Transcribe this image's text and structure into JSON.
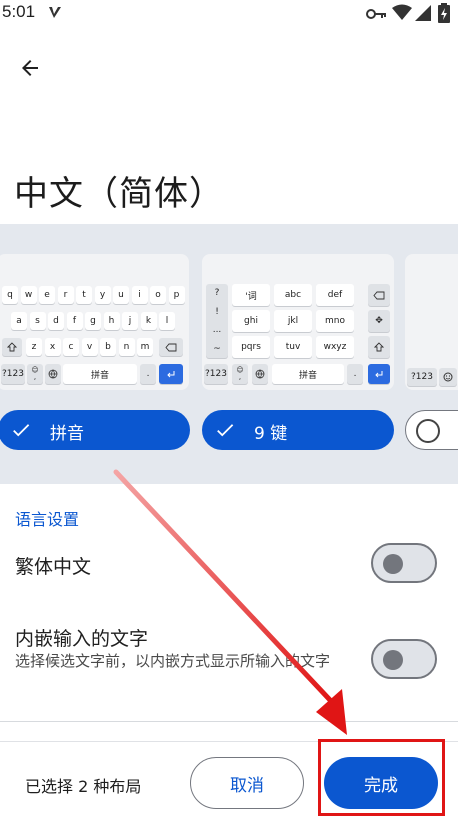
{
  "status_bar": {
    "time": "5:01",
    "icons": [
      "app-notification-icon",
      "key-icon",
      "wifi-icon",
      "signal-icon",
      "battery-charging-icon"
    ]
  },
  "header": {
    "back_icon": "arrow-back-icon",
    "title": "中文（简体）"
  },
  "keyboard_layouts": [
    {
      "label": "拼音",
      "selected": true,
      "preview": {
        "row1": [
          "q",
          "w",
          "e",
          "r",
          "t",
          "y",
          "u",
          "i",
          "o",
          "p"
        ],
        "row2": [
          "a",
          "s",
          "d",
          "f",
          "g",
          "h",
          "j",
          "k",
          "l"
        ],
        "row3": [
          "z",
          "x",
          "c",
          "v",
          "b",
          "n",
          "m"
        ],
        "space_label": "拼音",
        "symbols_key": "?123"
      }
    },
    {
      "label": "9 键",
      "selected": true,
      "preview": {
        "side_keys": [
          "?",
          "!",
          "...",
          "~"
        ],
        "grid": [
          "'词",
          "abc",
          "def",
          "ghi",
          "jkl",
          "mno",
          "pqrs",
          "tuv",
          "wxyz"
        ],
        "space_label": "拼音",
        "symbols_key": "?123"
      }
    },
    {
      "label": "",
      "selected": false,
      "preview": {
        "symbols_key": "?123"
      }
    }
  ],
  "language_settings": {
    "section_title": "语言设置",
    "settings": [
      {
        "label": "繁体中文",
        "enabled": false
      },
      {
        "label": "内嵌输入的文字",
        "description": "选择候选文字前，以内嵌方式显示所输入的文字",
        "enabled": false
      }
    ]
  },
  "bottom_bar": {
    "selection_count": "已选择 2 种布局",
    "cancel_label": "取消",
    "done_label": "完成"
  },
  "colors": {
    "accent": "#0b57d0",
    "panel_bg": "#e4e8ee",
    "annotation_red": "#e01515"
  }
}
